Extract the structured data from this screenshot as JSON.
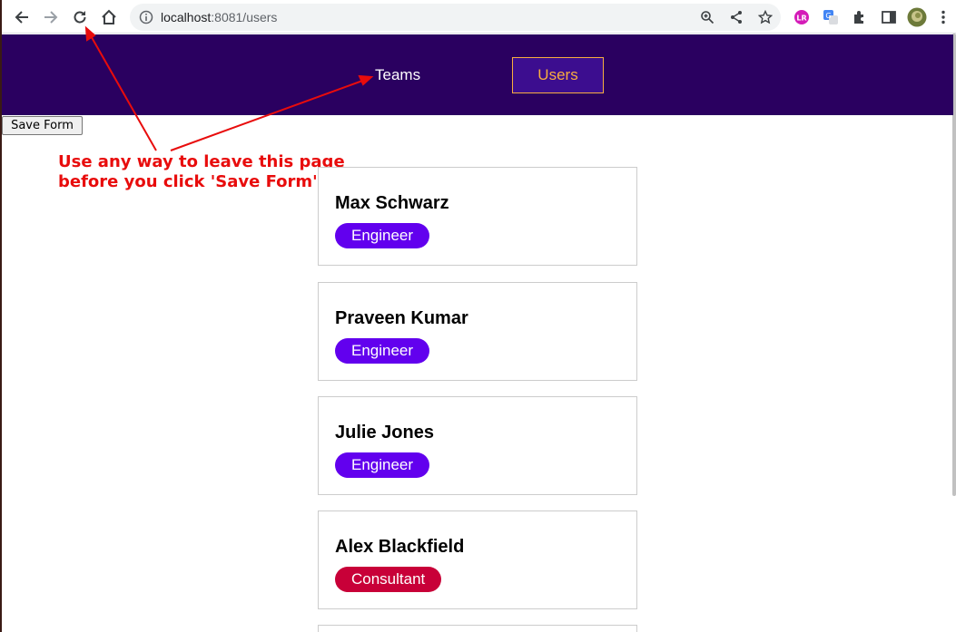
{
  "browser": {
    "url_host": "localhost",
    "url_path": ":8081/users"
  },
  "nav": {
    "teams_label": "Teams",
    "users_label": "Users"
  },
  "save_form_label": "Save Form",
  "annotation": {
    "line1": "Use any way to leave this page",
    "line2": "before you click 'Save Form'"
  },
  "users": [
    {
      "name": "Max Schwarz",
      "role": "Engineer",
      "role_color": "#6200ee"
    },
    {
      "name": "Praveen Kumar",
      "role": "Engineer",
      "role_color": "#6200ee"
    },
    {
      "name": "Julie Jones",
      "role": "Engineer",
      "role_color": "#6200ee"
    },
    {
      "name": "Alex Blackfield",
      "role": "Consultant",
      "role_color": "#c80038"
    }
  ],
  "colors": {
    "header_bg": "#2a0060",
    "accent": "#f9ad3f",
    "annotation": "#e80c0c"
  },
  "icons": [
    "back-icon",
    "forward-icon",
    "reload-icon",
    "home-icon",
    "info-icon",
    "zoom-icon",
    "share-icon",
    "star-icon",
    "extension-lr-icon",
    "translate-icon",
    "puzzle-icon",
    "sidepanel-icon",
    "profile-avatar",
    "menu-icon"
  ]
}
